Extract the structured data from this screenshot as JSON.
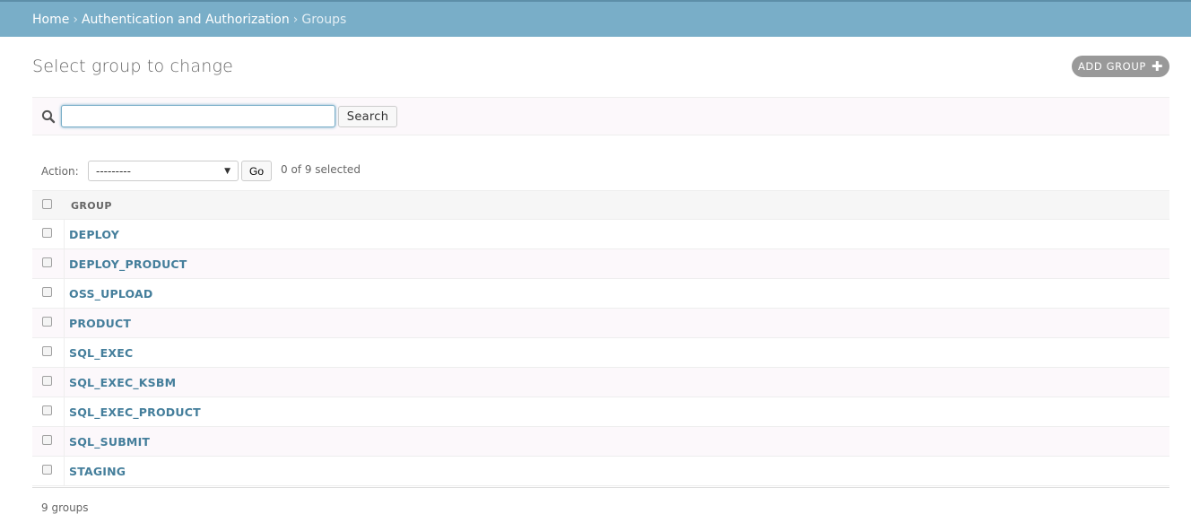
{
  "breadcrumbs": {
    "home": "Home",
    "separator": "›",
    "app": "Authentication and Authorization",
    "current": "Groups"
  },
  "page": {
    "title": "Select group to change",
    "add_button": "ADD GROUP"
  },
  "search": {
    "value": "",
    "placeholder": "",
    "button": "Search"
  },
  "actions": {
    "label": "Action:",
    "selected_option": "---------",
    "go": "Go",
    "selected_counter": "0 of 9 selected"
  },
  "table": {
    "column_header": "GROUP",
    "rows": [
      "DEPLOY",
      "DEPLOY_PRODUCT",
      "OSS_UPLOAD",
      "PRODUCT",
      "SQL_EXEC",
      "SQL_EXEC_KSBM",
      "SQL_EXEC_PRODUCT",
      "SQL_SUBMIT",
      "STAGING"
    ]
  },
  "paginator": {
    "count": "9 groups"
  },
  "colors": {
    "header_bar": "#79aec8",
    "link": "#447e9b",
    "add_button": "#999999"
  },
  "icons": {
    "search": "search-icon",
    "add": "plus-icon"
  }
}
